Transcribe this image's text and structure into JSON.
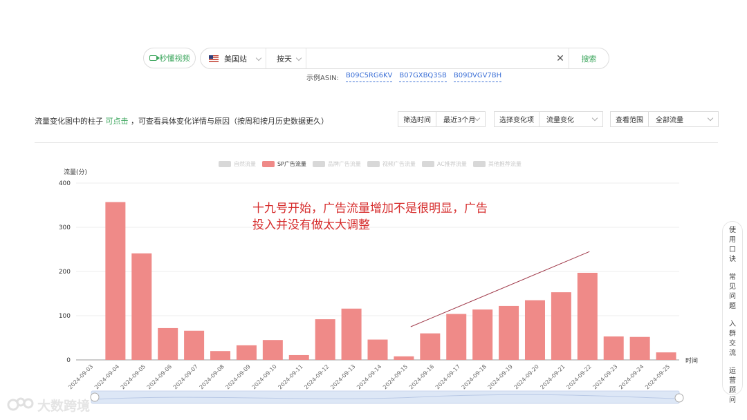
{
  "top": {
    "video_button": "秒懂视频",
    "site": "美国站",
    "period": "按天",
    "search_value": "",
    "search_button": "搜索",
    "examples_label": "示例ASIN:",
    "example_asins": [
      "B09C5RG6KV",
      "B07GXBQ3SB",
      "B09DVGV7BH"
    ]
  },
  "filters": {
    "hint_prefix": "流量变化图中的柱子",
    "hint_green": "可点击",
    "hint_suffix": "，可查看具体变化详情与原因（按周和按月历史数据更久）",
    "time_label": "筛选时间",
    "time_value": "最近3个月",
    "change_label": "选择变化项",
    "change_value": "流量变化",
    "scope_label": "查看范围",
    "scope_value": "全部流量"
  },
  "annotation": "十九号开始，广告流量增加不是很明显，广告投入并没有做太大调整",
  "side_float": [
    "使用口诀",
    "常见问题",
    "入群交流",
    "运营顾问"
  ],
  "watermark": "大数跨境",
  "colors": {
    "bar": "#ef8a88",
    "accent": "#3aa55b",
    "annotation": "#d62c2c",
    "link": "#3b6fd6"
  },
  "chart_data": {
    "type": "bar",
    "ylabel": "流量(分)",
    "xlabel": "时间",
    "ylim": [
      0,
      400
    ],
    "yticks": [
      0,
      100,
      200,
      300,
      400
    ],
    "grid": true,
    "legend_position": "top",
    "legend": [
      {
        "name": "自然流量",
        "active": false
      },
      {
        "name": "SP广告流量",
        "active": true
      },
      {
        "name": "品牌广告流量",
        "active": false
      },
      {
        "name": "视频广告流量",
        "active": false
      },
      {
        "name": "AC推荐流量",
        "active": false
      },
      {
        "name": "其他推荐流量",
        "active": false
      }
    ],
    "categories": [
      "2024-09-03",
      "2024-09-04",
      "2024-09-05",
      "2024-09-06",
      "2024-09-07",
      "2024-09-08",
      "2024-09-09",
      "2024-09-10",
      "2024-09-11",
      "2024-09-12",
      "2024-09-13",
      "2024-09-14",
      "2024-09-15",
      "2024-09-16",
      "2024-09-17",
      "2024-09-18",
      "2024-09-19",
      "2024-09-20",
      "2024-09-21",
      "2024-09-22",
      "2024-09-23",
      "2024-09-24",
      "2024-09-25"
    ],
    "series": [
      {
        "name": "SP广告流量",
        "values": [
          0,
          357,
          241,
          72,
          66,
          20,
          33,
          45,
          11,
          92,
          116,
          46,
          8,
          60,
          104,
          114,
          122,
          135,
          153,
          197,
          53,
          52,
          17
        ]
      }
    ],
    "trend_line": {
      "from": {
        "x": "2024-09-16",
        "y": 75
      },
      "to": {
        "x": "2024-09-22",
        "y": 245
      }
    }
  }
}
